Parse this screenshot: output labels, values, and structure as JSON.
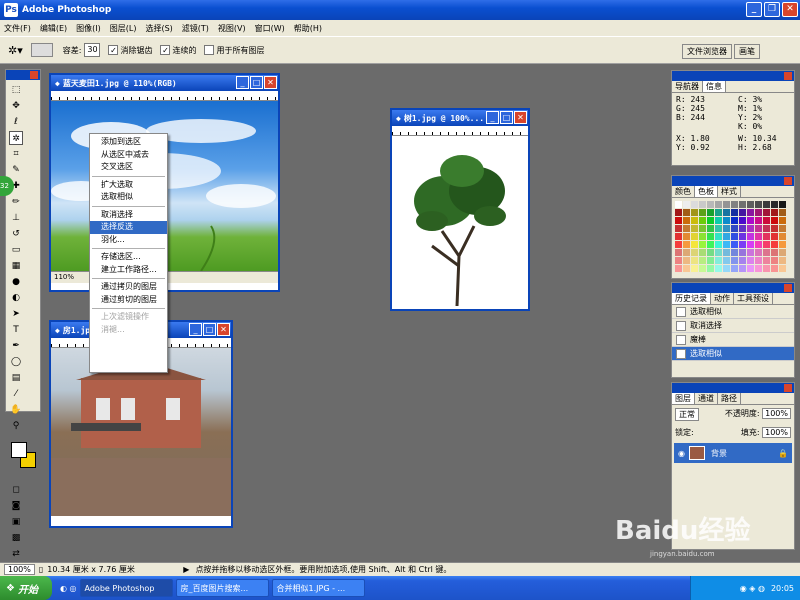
{
  "app": {
    "title": "Adobe Photoshop",
    "logo": "Ps"
  },
  "menu": [
    "文件(F)",
    "编辑(E)",
    "图像(I)",
    "图层(L)",
    "选择(S)",
    "滤镜(T)",
    "视图(V)",
    "窗口(W)",
    "帮助(H)"
  ],
  "options": {
    "tolerance_label": "容差:",
    "tolerance_value": "30",
    "antialias": "消除锯齿",
    "contiguous": "连续的",
    "all_layers": "用于所有图层"
  },
  "well_tabs": [
    "文件浏览器",
    "画笔"
  ],
  "docs": [
    {
      "title": "蓝天麦田1.jpg @ 110%(RGB)",
      "status": "110%"
    },
    {
      "title": "房1.jpg @ ...",
      "status": ""
    },
    {
      "title": "树1.jpg @ 100%...",
      "status": ""
    }
  ],
  "context_menu": {
    "items": [
      "添加到选区",
      "从选区中减去",
      "交叉选区",
      "扩大选取",
      "选取相似",
      "取消选择",
      "选择反选",
      "羽化...",
      "存储选区...",
      "建立工作路径...",
      "通过拷贝的图层",
      "通过剪切的图层",
      "上次滤镜操作",
      "消褪..."
    ],
    "selected": "选择反选",
    "disabled": [
      "上次滤镜操作",
      "消褪..."
    ]
  },
  "info_panel": {
    "tabs": [
      "导航器",
      "信息"
    ],
    "rgb": {
      "R": "243",
      "G": "245",
      "B": "244"
    },
    "cmyk": {
      "C": "3%",
      "M": "1%",
      "Y": "2%",
      "K": "0%"
    },
    "xy": {
      "X": "1.80",
      "Y": "0.92"
    },
    "wh": {
      "W": "10.34",
      "H": "2.68"
    }
  },
  "swatch_panel": {
    "tabs": [
      "颜色",
      "色板",
      "样式"
    ]
  },
  "history_panel": {
    "tabs": [
      "历史记录",
      "动作",
      "工具预设"
    ],
    "rows": [
      "选取相似",
      "取消选择",
      "魔棒",
      "选取相似"
    ],
    "selected_index": 3
  },
  "layers_panel": {
    "tabs": [
      "图层",
      "通道",
      "路径"
    ],
    "mode": "正常",
    "opacity_label": "不透明度:",
    "opacity": "100%",
    "lock_label": "锁定:",
    "fill_label": "填充:",
    "fill": "100%",
    "layer_name": "背景"
  },
  "statusbar": {
    "zoom": "100%",
    "size": "10.34 厘米 x 7.76 厘米",
    "hint": "点按并拖移以移动选区外框。要用附加选项,使用 Shift、Alt 和 Ctrl 键。"
  },
  "taskbar": {
    "start": "开始",
    "tasks": [
      "Adobe Photoshop",
      "房_百度图片搜索...",
      "合并相似1.JPG - ..."
    ],
    "time": "20:05"
  },
  "watermark": {
    "brand": "Baidu经验",
    "url": "jingyan.baidu.com"
  }
}
